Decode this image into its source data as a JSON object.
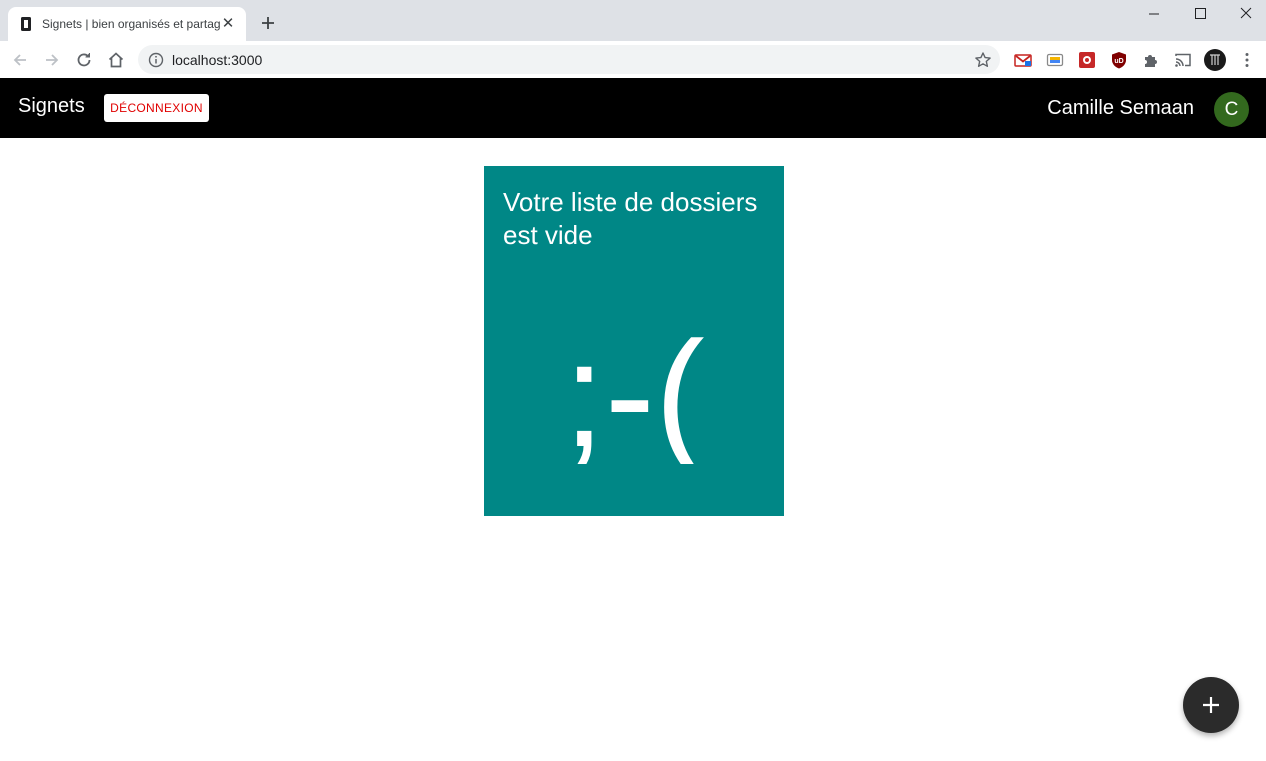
{
  "browser": {
    "tab_title": "Signets | bien organisés et partagés",
    "tab_close_glyph": "✕",
    "url": "localhost:3000"
  },
  "app": {
    "brand": "Signets",
    "logout_label": "DÉCONNEXION",
    "user_name": "Camille Semaan",
    "avatar_initial": "C",
    "avatar_color": "#33691e"
  },
  "empty_state": {
    "title": "Votre liste de dossiers est vide",
    "emoticon": ";-(",
    "card_color": "#008786"
  },
  "fab": {
    "icon": "plus-icon"
  }
}
